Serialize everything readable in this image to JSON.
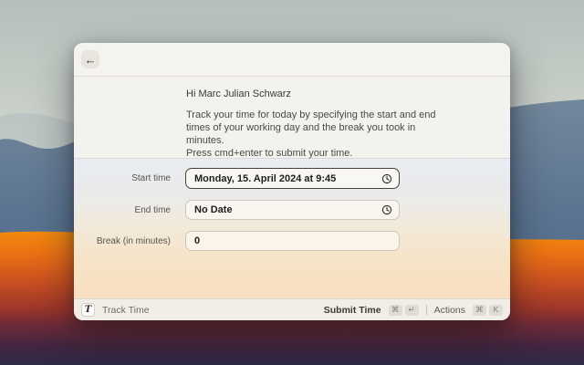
{
  "window": {
    "back_button": "←",
    "greeting": "Hi Marc Julian Schwarz",
    "description_lines": [
      "Track your time for today by specifying the start and end",
      "times of your working day and the break you took in",
      "minutes.",
      "Press cmd+enter to submit your time."
    ]
  },
  "form": {
    "fields": [
      {
        "label": "Start time",
        "value": "Monday, 15. April 2024 at 9:45",
        "has_clock_icon": true,
        "focused": true
      },
      {
        "label": "End time",
        "value": "No Date",
        "has_clock_icon": true,
        "focused": false
      },
      {
        "label": "Break (in minutes)",
        "value": "0",
        "has_clock_icon": false,
        "focused": false
      }
    ]
  },
  "footer": {
    "extension_icon_glyph": "T",
    "extension_name": "Track Time",
    "primary_action": "Submit Time",
    "primary_keys": [
      "⌘",
      "↵"
    ],
    "secondary_action": "Actions",
    "secondary_keys": [
      "⌘",
      "K"
    ]
  },
  "colors": {
    "focus_border": "#45413b",
    "window_bg": "#f3f2ee",
    "wallpaper_sky": "#c3ccc6",
    "wallpaper_mountain": "#5d7894",
    "wallpaper_orange": "#ee7c12",
    "wallpaper_bottom": "#2e2a47"
  }
}
